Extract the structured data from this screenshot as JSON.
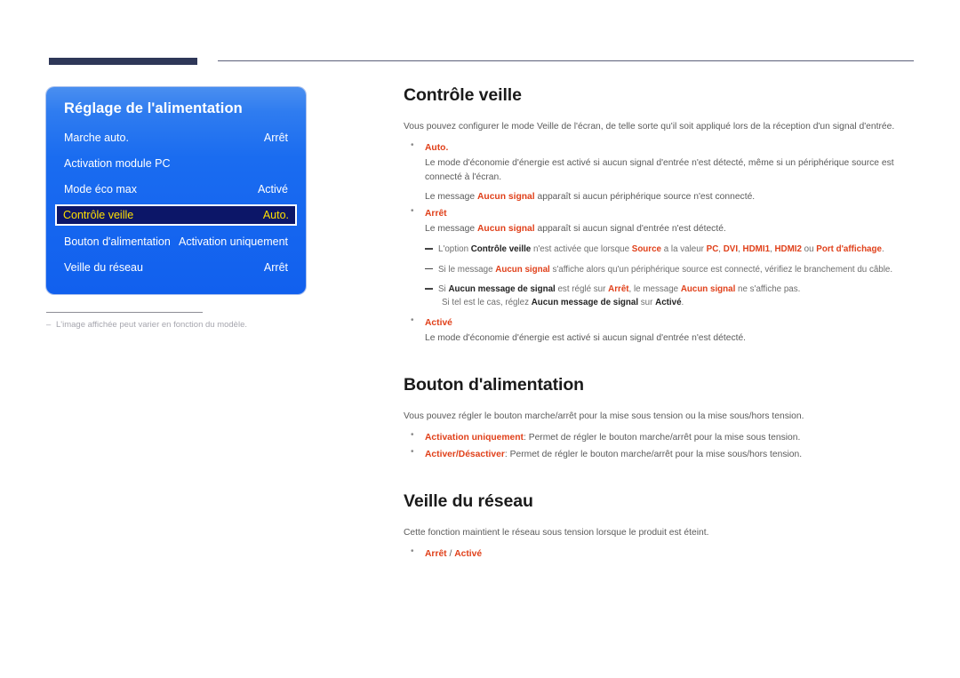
{
  "page": {
    "top_rule": {
      "bar_color": "#2e3758",
      "line_color": "#5b5f7a"
    }
  },
  "osd": {
    "title": "Réglage de l'alimentation",
    "panel_color": "#1a6cf0",
    "selected_bg": "#0c1668",
    "selected_fg": "#ffe000",
    "rows": [
      {
        "label": "Marche auto.",
        "value": "Arrêt",
        "selected": false
      },
      {
        "label": "Activation module PC",
        "value": "",
        "selected": false
      },
      {
        "label": "Mode éco max",
        "value": "Activé",
        "selected": false
      },
      {
        "label": "Contrôle veille",
        "value": "Auto.",
        "selected": true
      },
      {
        "label": "Bouton d'alimentation",
        "value": "Activation uniquement",
        "selected": false
      },
      {
        "label": "Veille du réseau",
        "value": "Arrêt",
        "selected": false
      }
    ],
    "footnote": {
      "dash": "–",
      "text": "L'image affichée peut varier en fonction du modèle."
    }
  },
  "accent": {
    "red": "#e0401a",
    "dark": "#222222",
    "body": "#5a5a5a"
  },
  "sections": {
    "controle_veille": {
      "title": "Contrôle veille",
      "intro": "Vous pouvez configurer le mode Veille de l'écran, de telle sorte qu'il soit appliqué lors de la réception d'un signal d'entrée.",
      "bullet_auto": {
        "head": "Auto.",
        "line1": "Le mode d'économie d'énergie est activé si aucun signal d'entrée n'est détecté, même si un périphérique source est connecté à l'écran.",
        "line2_pre": "Le message ",
        "line2_em": "Aucun signal",
        "line2_post": " apparaît si aucun périphérique source n'est connecté."
      },
      "bullet_arret": {
        "head": "Arrêt",
        "line1_pre": "Le message ",
        "line1_em": "Aucun signal",
        "line1_post": " apparaît si aucun signal d'entrée n'est détecté."
      },
      "notes": {
        "n1": {
          "p1": "L'option ",
          "em1": "Contrôle veille",
          "p2": " n'est activée que lorsque ",
          "em2": "Source",
          "p3": " a la valeur ",
          "em3": "PC",
          "p4": ", ",
          "em4": "DVI",
          "p5": ", ",
          "em5": "HDMI1",
          "p6": ", ",
          "em6": "HDMI2",
          "p7": " ou ",
          "em7": "Port d'affichage",
          "p8": "."
        },
        "n2": {
          "p1": "Si le message ",
          "em1": "Aucun signal",
          "p2": " s'affiche alors qu'un périphérique source est connecté, vérifiez le branchement du câble."
        },
        "n3": {
          "p1": "Si ",
          "em1": "Aucun message de signal",
          "p2": " est réglé sur ",
          "em2": "Arrêt",
          "p3": ", le message ",
          "em3": "Aucun signal",
          "p4": " ne s'affiche pas.",
          "cont_p1": "Si tel est le cas, réglez ",
          "cont_em1": "Aucun message de signal",
          "cont_p2": " sur ",
          "cont_em2": "Activé",
          "cont_p3": "."
        }
      },
      "bullet_active": {
        "head": "Activé",
        "line1": "Le mode d'économie d'énergie est activé si aucun signal d'entrée n'est détecté."
      }
    },
    "bouton_alimentation": {
      "title": "Bouton d'alimentation",
      "intro": "Vous pouvez régler le bouton marche/arrêt pour la mise sous tension ou la mise sous/hors tension.",
      "bullets": [
        {
          "em": "Activation uniquement",
          "rest": ": Permet de régler le bouton marche/arrêt pour la mise sous tension."
        },
        {
          "em": "Activer/Désactiver",
          "rest": ": Permet de régler le bouton marche/arrêt pour la mise sous/hors tension."
        }
      ]
    },
    "veille_reseau": {
      "title": "Veille du réseau",
      "intro": "Cette fonction maintient le réseau sous tension lorsque le produit est éteint.",
      "bullet": {
        "em1": "Arrêt",
        "sep": " / ",
        "em2": "Activé"
      }
    }
  }
}
